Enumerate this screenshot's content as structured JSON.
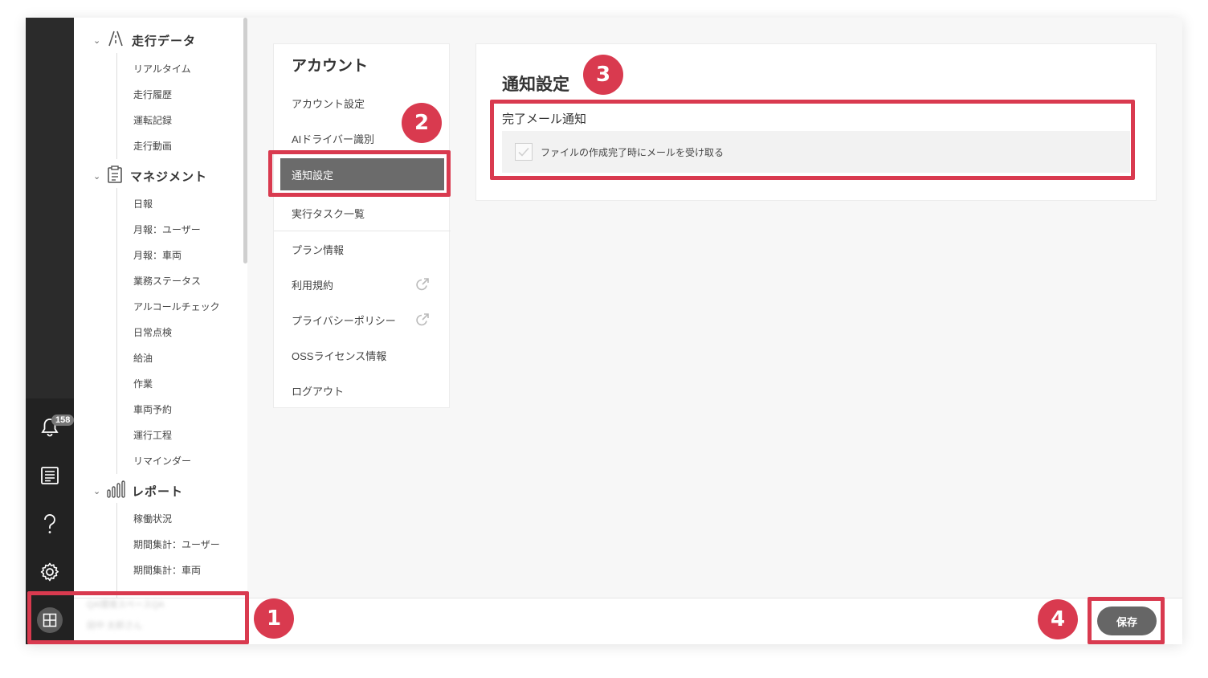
{
  "nav": {
    "sections": [
      {
        "label": "走行データ",
        "icon": "road-icon",
        "items": [
          "リアルタイム",
          "走行履歴",
          "運転記録",
          "走行動画"
        ]
      },
      {
        "label": "マネジメント",
        "icon": "clipboard-icon",
        "items": [
          "日報",
          "月報：ユーザー",
          "月報：車両",
          "業務ステータス",
          "アルコールチェック",
          "日常点検",
          "給油",
          "作業",
          "車両予約",
          "運行工程",
          "リマインダー"
        ]
      },
      {
        "label": "レポート",
        "icon": "bar-chart-icon",
        "items": [
          "稼働状況",
          "期間集計：ユーザー",
          "期間集計：車両"
        ]
      }
    ]
  },
  "rail": {
    "notification_count": "158"
  },
  "account_menu": {
    "title": "アカウント",
    "items": [
      "アカウント設定",
      "AIドライバー識別",
      "通知設定",
      "実行タスク一覧",
      "プラン情報",
      "利用規約",
      "プライバシーポリシー",
      "OSSライセンス情報",
      "ログアウト"
    ],
    "active_index": 2
  },
  "notification_settings": {
    "title": "通知設定",
    "field_label": "完了メール通知",
    "checkbox_label": "ファイルの作成完了時にメールを受け取る",
    "checked": true
  },
  "footer": {
    "save_label": "保存",
    "user_line1": "QA環境スペースQA",
    "user_line2": "田中 太郎さん"
  },
  "annotations": [
    "1",
    "2",
    "3",
    "4"
  ],
  "accent_color": "#d93a4f"
}
